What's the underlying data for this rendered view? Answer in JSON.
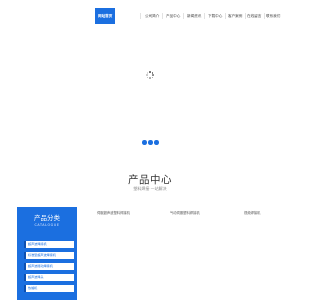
{
  "nav": {
    "items": [
      {
        "label": "网站首页",
        "active": true
      },
      {
        "label": "公司简介",
        "active": false
      },
      {
        "label": "产品中心",
        "active": false
      },
      {
        "label": "新闻资讯",
        "active": false
      },
      {
        "label": "下载中心",
        "active": false
      },
      {
        "label": "客户案例",
        "active": false
      },
      {
        "label": "在线留言",
        "active": false
      },
      {
        "label": "联系我们",
        "active": false
      }
    ]
  },
  "loading": {
    "icon": "spinner-icon"
  },
  "slider": {
    "dot_count": 3,
    "dot_color": "#1b6fe0"
  },
  "products_section": {
    "title": "产品中心",
    "subtitle": "塑料焊接 一站解决"
  },
  "sidebar": {
    "title": "产品分类",
    "subtitle": "CATALOGUE",
    "categories": [
      "超声波焊接机",
      "标准型超声波焊接机",
      "超声波振动焊接机",
      "超声波焊头",
      "热熔机"
    ]
  },
  "products": [
    "伺服超声波塑料焊接机",
    "气动伺服塑料焊接机",
    "视频焊接机"
  ],
  "colors": {
    "accent": "#1b6fe0",
    "accent_dark": "#0d4fb0"
  }
}
